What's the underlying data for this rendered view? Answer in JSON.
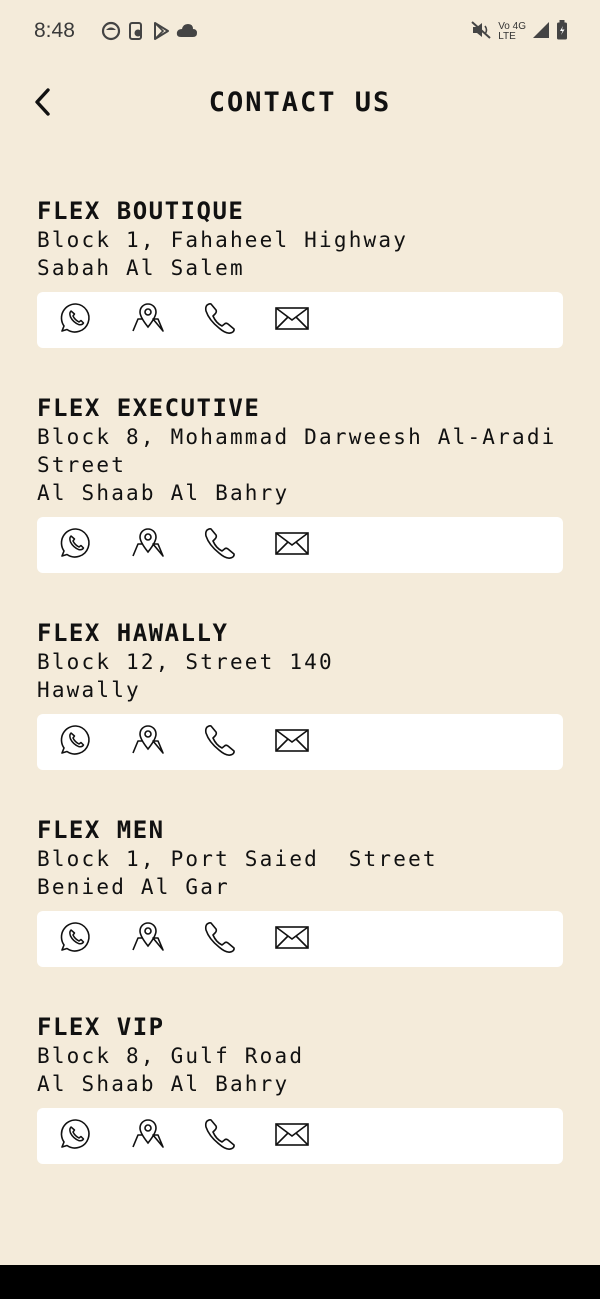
{
  "status_bar": {
    "time": "8:48",
    "left_icons": [
      "circle-app-icon",
      "phone-app-icon",
      "play-store-icon",
      "cloud-icon"
    ],
    "volte_top": "Vo",
    "volte_bottom": "LTE",
    "network": "4G",
    "right_icons": [
      "mute-icon",
      "signal-icon",
      "battery-icon"
    ]
  },
  "header": {
    "title": "CONTACT US",
    "back_icon": "chevron-left-icon"
  },
  "stores": [
    {
      "name": "FLEX BOUTIQUE",
      "address_lines": [
        "Block 1, Fahaheel Highway",
        "Sabah Al Salem"
      ]
    },
    {
      "name": "FLEX EXECUTIVE",
      "address_lines": [
        "Block 8, Mohammad Darweesh Al-Aradi",
        "Street",
        "Al Shaab Al Bahry"
      ]
    },
    {
      "name": "FLEX HAWALLY",
      "address_lines": [
        "Block 12, Street 140",
        "Hawally"
      ]
    },
    {
      "name": "FLEX MEN",
      "address_lines": [
        "Block 1, Port Saied  Street",
        "Benied Al Gar"
      ]
    },
    {
      "name": "FLEX VIP",
      "address_lines": [
        "Block 8, Gulf Road",
        "Al Shaab Al Bahry"
      ]
    }
  ],
  "action_icons": [
    "whatsapp-icon",
    "map-pin-icon",
    "phone-icon",
    "mail-icon"
  ],
  "colors": {
    "background": "#f4ebda",
    "card": "#ffffff",
    "text": "#111111"
  }
}
